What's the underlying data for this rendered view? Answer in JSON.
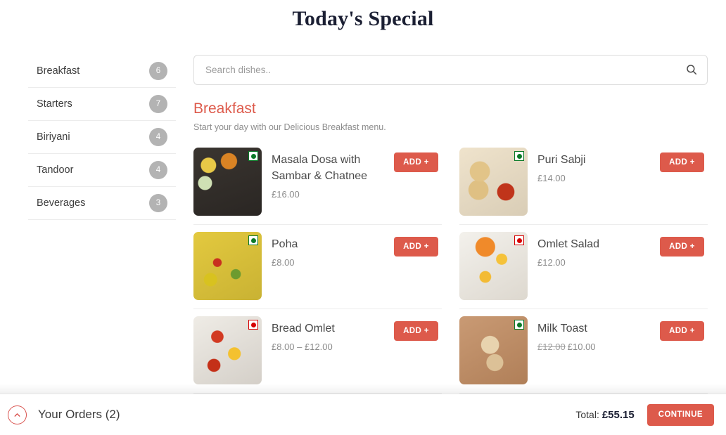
{
  "header": {
    "title": "Today's Special"
  },
  "sidebar": {
    "items": [
      {
        "label": "Breakfast",
        "count": "6"
      },
      {
        "label": "Starters",
        "count": "7"
      },
      {
        "label": "Biriyani",
        "count": "4"
      },
      {
        "label": "Tandoor",
        "count": "4"
      },
      {
        "label": "Beverages",
        "count": "3"
      }
    ]
  },
  "search": {
    "placeholder": "Search dishes..",
    "value": "",
    "icon": "search-icon"
  },
  "section": {
    "title": "Breakfast",
    "subtitle": "Start your day with our Delicious Breakfast menu."
  },
  "dishes": [
    {
      "name": "Masala Dosa with Sambar & Chatnee",
      "price": "£16.00",
      "old_price": "",
      "diet": "veg",
      "add_label": "ADD +",
      "img": "masala-dosa"
    },
    {
      "name": "Puri Sabji",
      "price": "£14.00",
      "old_price": "",
      "diet": "veg",
      "add_label": "ADD +",
      "img": "puri-sabji"
    },
    {
      "name": "Poha",
      "price": "£8.00",
      "old_price": "",
      "diet": "veg",
      "add_label": "ADD +",
      "img": "poha"
    },
    {
      "name": "Omlet Salad",
      "price": "£12.00",
      "old_price": "",
      "diet": "nonveg",
      "add_label": "ADD +",
      "img": "omlet-salad"
    },
    {
      "name": "Bread Omlet",
      "price": "£8.00 – £12.00",
      "old_price": "",
      "diet": "nonveg",
      "add_label": "ADD +",
      "img": "bread-omlet"
    },
    {
      "name": "Milk Toast",
      "price": "£10.00",
      "old_price": "£12.00",
      "diet": "veg",
      "add_label": "ADD +",
      "img": "milk-toast"
    }
  ],
  "bottom_bar": {
    "toggle_icon": "chevron-up-icon",
    "orders_label": "Your Orders (2)",
    "total_label": "Total:",
    "total_value": "£55.15",
    "continue_label": "CONTINUE"
  },
  "colors": {
    "accent": "#dd5a4b",
    "title": "#1b1f33",
    "veg": "#0b7a28",
    "nonveg": "#d60000",
    "badge": "#b3b3b3"
  }
}
